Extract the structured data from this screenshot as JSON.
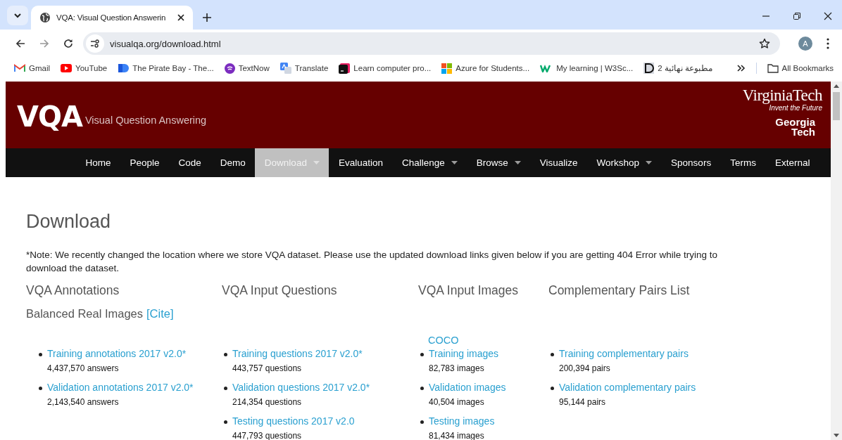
{
  "browser": {
    "tabs": [
      {
        "title": "VQA: Visual Question Answerin",
        "selected": true
      }
    ],
    "url": "visualqa.org/download.html",
    "profile_initial": "A",
    "bookmarks": [
      {
        "label": "Gmail",
        "kind": "gmail"
      },
      {
        "label": "YouTube",
        "kind": "youtube"
      },
      {
        "label": "The Pirate Bay - The...",
        "kind": "pirate"
      },
      {
        "label": "TextNow",
        "kind": "textnow"
      },
      {
        "label": "Translate",
        "kind": "translate"
      },
      {
        "label": "Learn computer pro...",
        "kind": "learn"
      },
      {
        "label": "Azure for Students...",
        "kind": "azure"
      },
      {
        "label": "My learning | W3Sc...",
        "kind": "w3"
      },
      {
        "label": "مطبوعة نهائية 2",
        "kind": "doc"
      }
    ],
    "all_bookmarks": "All Bookmarks"
  },
  "header": {
    "logo": "VQA",
    "tagline": "Visual Question Answering",
    "partner_1": "VirginiaTech",
    "partner_1_motto": "Invent the Future",
    "partner_2": "Georgia Tech"
  },
  "nav": [
    {
      "label": "Home",
      "selected": false,
      "has_menu": false
    },
    {
      "label": "People",
      "selected": false,
      "has_menu": false
    },
    {
      "label": "Code",
      "selected": false,
      "has_menu": false
    },
    {
      "label": "Demo",
      "selected": false,
      "has_menu": false
    },
    {
      "label": "Download",
      "selected": true,
      "has_menu": true
    },
    {
      "label": "Evaluation",
      "selected": false,
      "has_menu": false
    },
    {
      "label": "Challenge",
      "selected": false,
      "has_menu": true
    },
    {
      "label": "Browse",
      "selected": false,
      "has_menu": true
    },
    {
      "label": "Visualize",
      "selected": false,
      "has_menu": false
    },
    {
      "label": "Workshop",
      "selected": false,
      "has_menu": true
    },
    {
      "label": "Sponsors",
      "selected": false,
      "has_menu": false
    },
    {
      "label": "Terms",
      "selected": false,
      "has_menu": false
    },
    {
      "label": "External",
      "selected": false,
      "has_menu": false
    }
  ],
  "page": {
    "title": "Download",
    "note": "*Note: We recently changed the location where we store VQA dataset. Please use the updated download links given below if you are getting 404 Error while trying to download the dataset.",
    "columns": [
      {
        "heading": "VQA Annotations",
        "subheading": "Balanced Real Images",
        "subheading_link": "[Cite]",
        "items": [
          {
            "link": "Training annotations 2017 v2.0*",
            "count": "4,437,570 answers"
          },
          {
            "link": "Validation annotations 2017 v2.0*",
            "count": "2,143,540 answers"
          }
        ]
      },
      {
        "heading": "VQA Input Questions",
        "items": [
          {
            "link": "Training questions 2017 v2.0*",
            "count": "443,757 questions"
          },
          {
            "link": "Validation questions 2017 v2.0*",
            "count": "214,354 questions"
          },
          {
            "link": "Testing questions 2017 v2.0",
            "count": "447,793 questions"
          }
        ]
      },
      {
        "heading": "VQA Input Images",
        "group_link": "COCO",
        "items": [
          {
            "link": "Training images",
            "count": "82,783 images"
          },
          {
            "link": "Validation images",
            "count": "40,504 images"
          },
          {
            "link": "Testing images",
            "count": "81,434 images"
          }
        ]
      },
      {
        "heading": "Complementary Pairs List",
        "items": [
          {
            "link": "Training complementary pairs",
            "count": "200,394 pairs"
          },
          {
            "link": "Validation complementary pairs",
            "count": "95,144 pairs"
          }
        ]
      }
    ]
  }
}
